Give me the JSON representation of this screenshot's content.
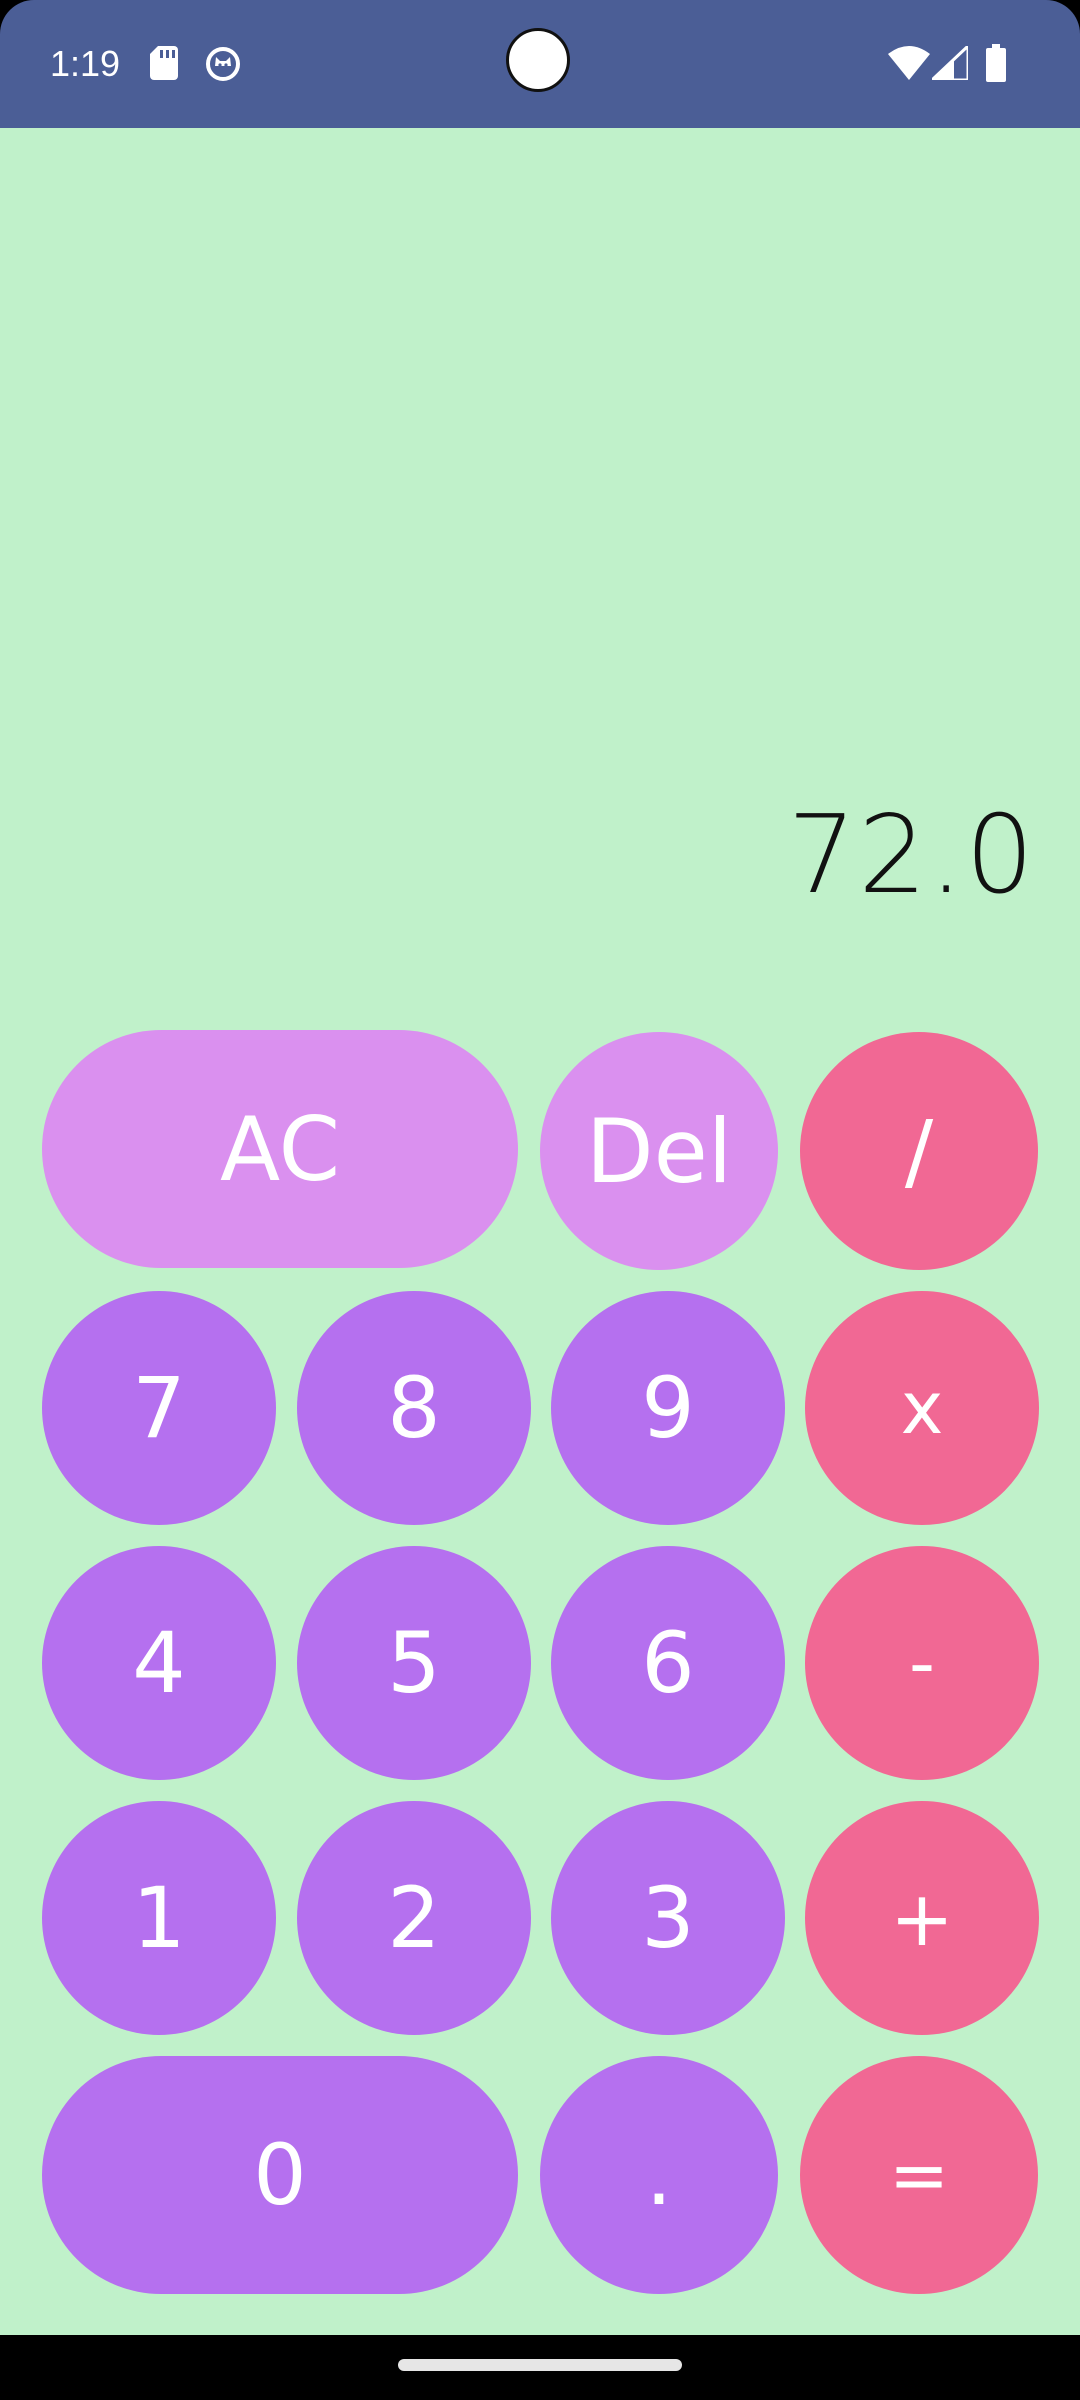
{
  "status_bar": {
    "time": "1:19",
    "icons": [
      "sd-card-icon",
      "cat-icon",
      "wifi-icon",
      "signal-icon",
      "battery-icon"
    ]
  },
  "calculator": {
    "display": "72.0",
    "keys": {
      "ac": "AC",
      "del": "Del",
      "divide": "/",
      "seven": "7",
      "eight": "8",
      "nine": "9",
      "multiply": "x",
      "four": "4",
      "five": "5",
      "six": "6",
      "minus": "-",
      "one": "1",
      "two": "2",
      "three": "3",
      "plus": "+",
      "zero": "0",
      "dot": ".",
      "equals": "="
    }
  },
  "colors": {
    "status_bar": "#4b5e96",
    "background": "#c0f1ca",
    "clear_keys": "#da90ef",
    "number_keys": "#b570ef",
    "operator_keys": "#f16894"
  }
}
